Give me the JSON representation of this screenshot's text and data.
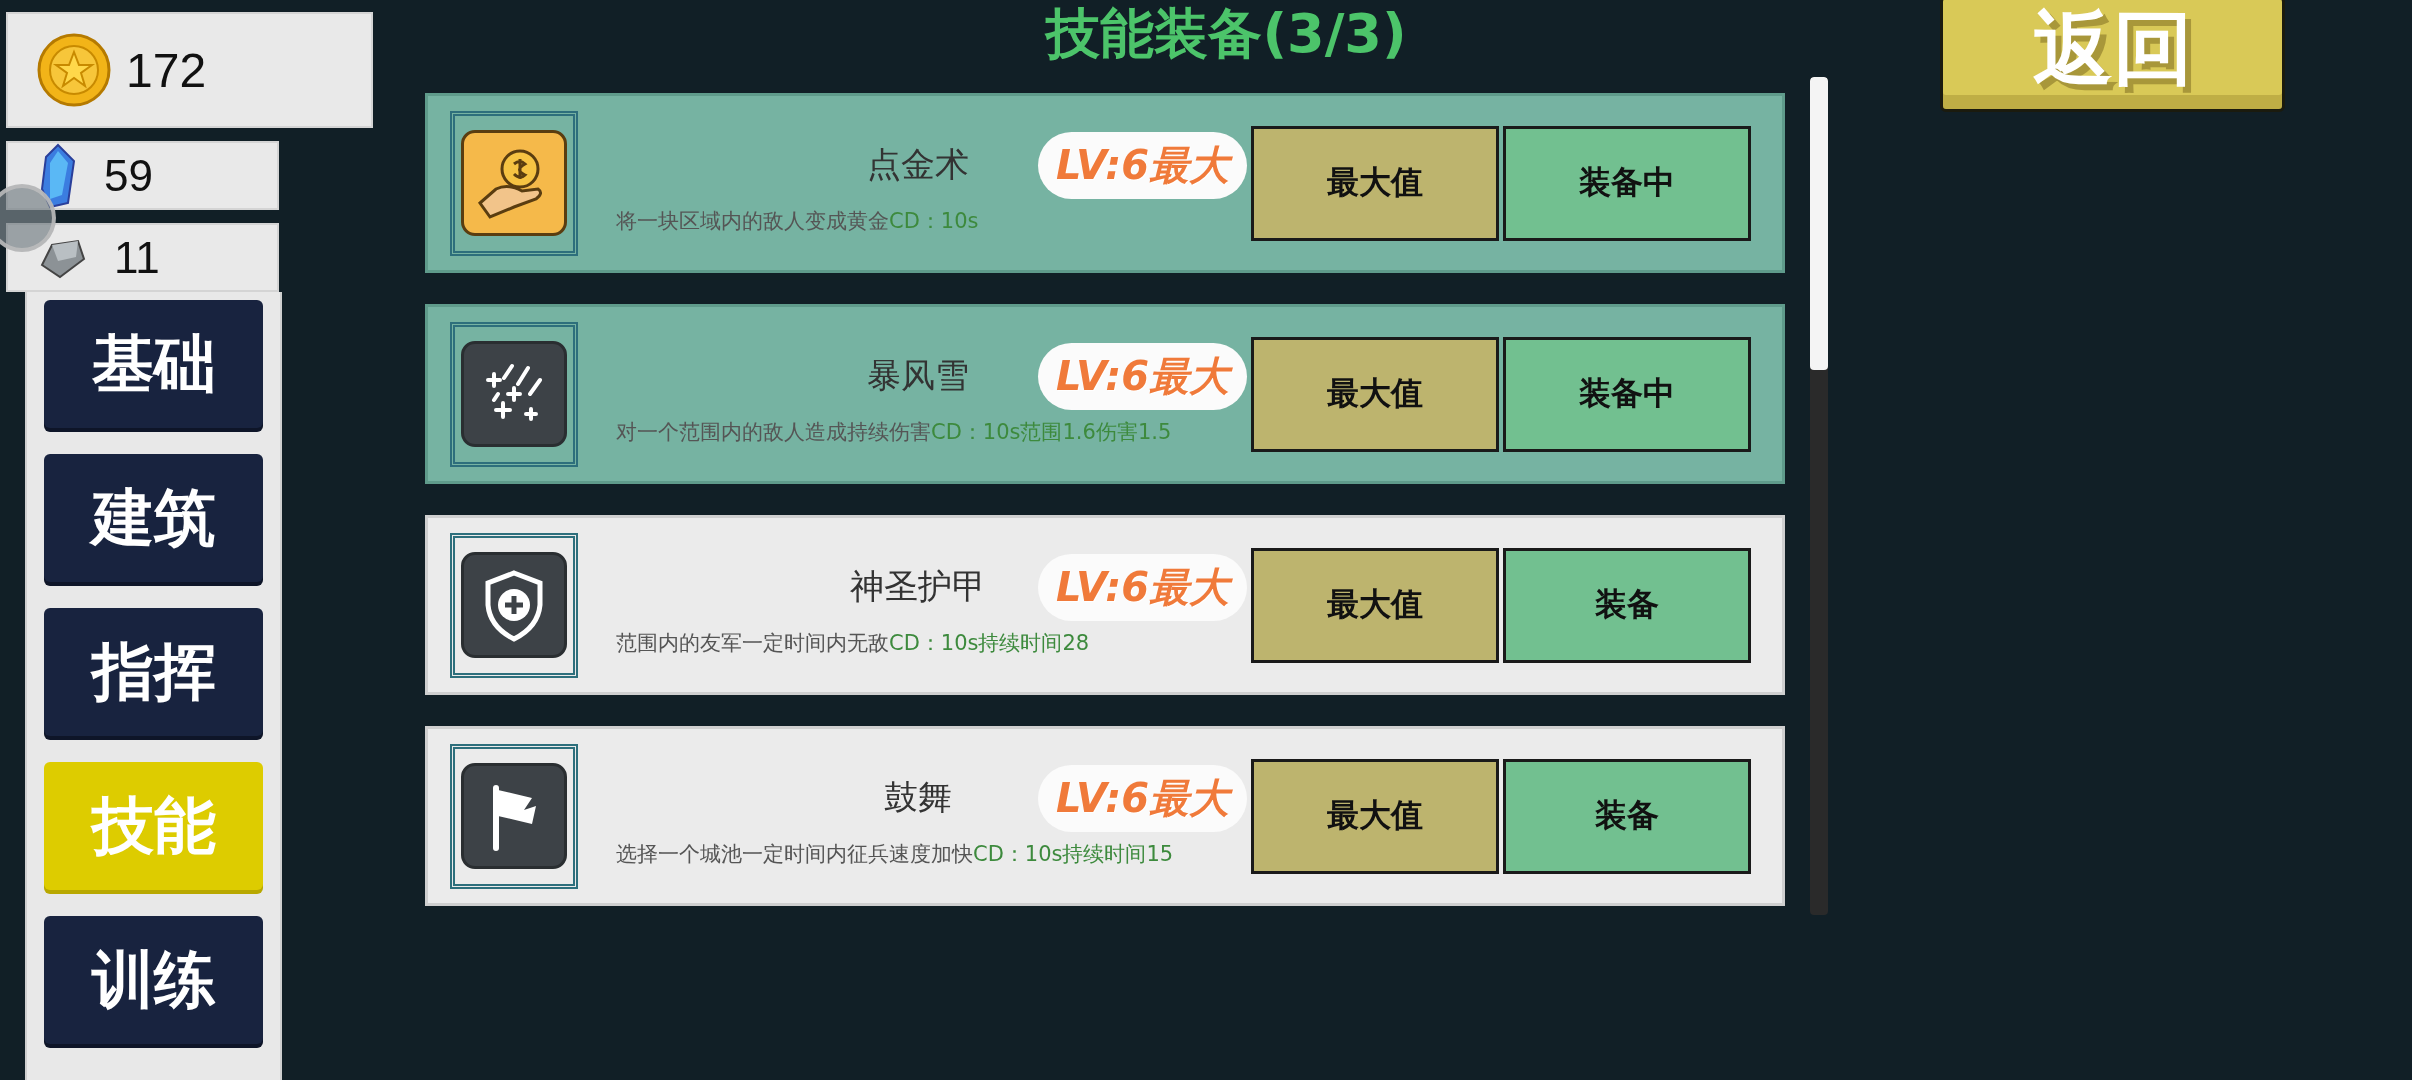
{
  "resources": [
    {
      "kind": "coin",
      "value": "172"
    },
    {
      "kind": "gem",
      "value": "59"
    },
    {
      "kind": "iron",
      "value": "11"
    }
  ],
  "sidebar": {
    "items": [
      {
        "label": "基础",
        "selected": false
      },
      {
        "label": "建筑",
        "selected": false
      },
      {
        "label": "指挥",
        "selected": false
      },
      {
        "label": "技能",
        "selected": true
      },
      {
        "label": "训练",
        "selected": false
      }
    ]
  },
  "title": "技能装备(3/3)",
  "back_button": "返回",
  "skills": [
    {
      "kind": "coin",
      "name": "点金术",
      "level": "LV:6最大",
      "description": "将一块区域内的敌人变成黄金",
      "stats": "CD：10s",
      "upgrade_button": "最大值",
      "equip_button": "装备中",
      "equipped": true
    },
    {
      "kind": "snow",
      "name": "暴风雪",
      "level": "LV:6最大",
      "description": "对一个范围内的敌人造成持续伤害",
      "stats": "CD：10s范围1.6伤害1.5",
      "upgrade_button": "最大值",
      "equip_button": "装备中",
      "equipped": true
    },
    {
      "kind": "shield",
      "name": "神圣护甲",
      "level": "LV:6最大",
      "description": "范围内的友军一定时间内无敌",
      "stats": "CD：10s持续时间28",
      "upgrade_button": "最大值",
      "equip_button": "装备",
      "equipped": false
    },
    {
      "kind": "flag",
      "name": "鼓舞",
      "level": "LV:6最大",
      "description": "选择一个城池一定时间内征兵速度加快",
      "stats": "CD：10s持续时间15",
      "upgrade_button": "最大值",
      "equip_button": "装备",
      "equipped": false
    }
  ]
}
